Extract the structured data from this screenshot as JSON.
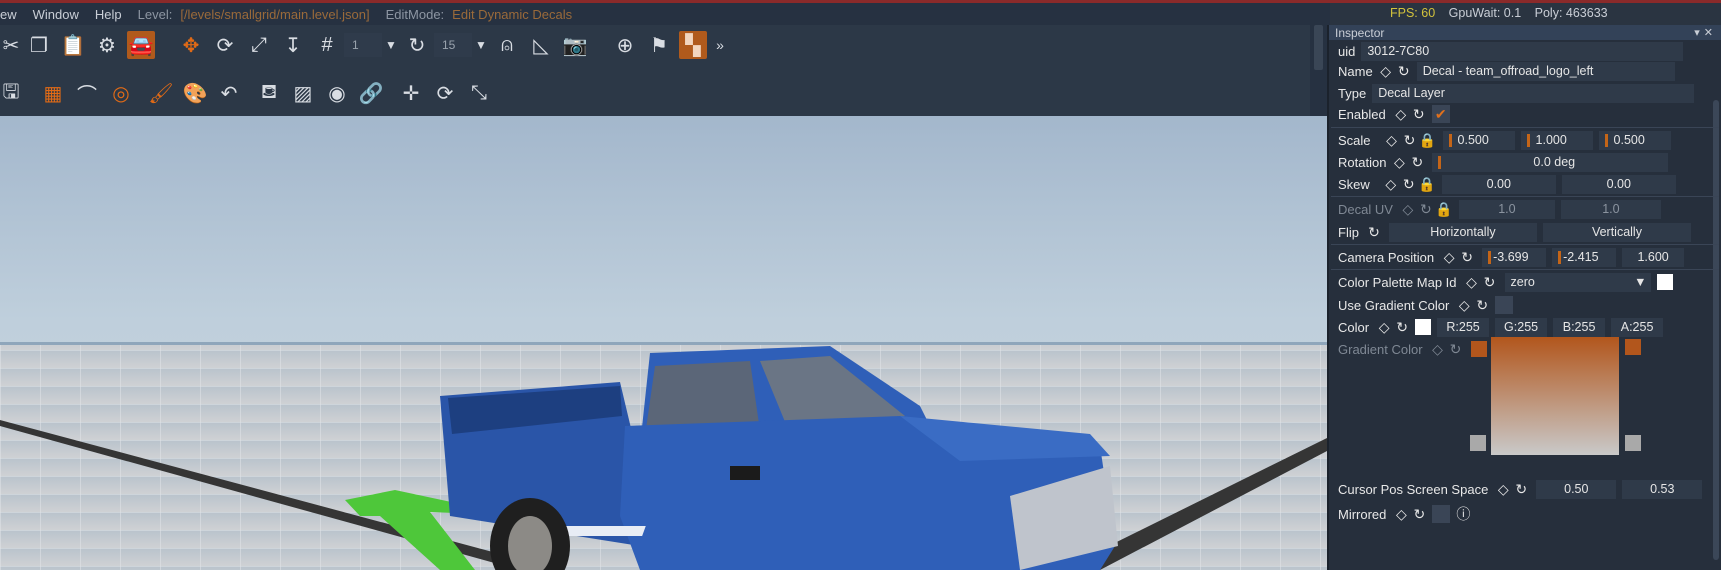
{
  "menu": {
    "items": [
      "ew",
      "Window",
      "Help"
    ],
    "level_label": "Level:",
    "level_path": "[/levels/smallgrid/main.level.json]",
    "editmode_label": "EditMode:",
    "editmode_value": "Edit Dynamic Decals"
  },
  "stats": {
    "fps": "FPS: 60",
    "gpuwait": "GpuWait: 0.1",
    "poly": "Poly: 463633"
  },
  "toolbar1": {
    "snap_value": "1",
    "rotate_value": "15"
  },
  "inspector": {
    "title": "Inspector",
    "uid_label": "uid",
    "uid_value": "3012-7C80",
    "name_label": "Name",
    "name_value": "Decal - team_offroad_logo_left",
    "type_label": "Type",
    "type_value": "Decal Layer",
    "enabled_label": "Enabled",
    "scale_label": "Scale",
    "scale_values": [
      "0.500",
      "1.000",
      "0.500"
    ],
    "rotation_label": "Rotation",
    "rotation_value": "0.0 deg",
    "skew_label": "Skew",
    "skew_values": [
      "0.00",
      "0.00"
    ],
    "decal_uv_label": "Decal UV",
    "decal_uv_values": [
      "1.0",
      "1.0"
    ],
    "flip_label": "Flip",
    "flip_h": "Horizontally",
    "flip_v": "Vertically",
    "camera_label": "Camera Position",
    "camera_values": [
      "-3.699",
      "-2.415",
      "1.600"
    ],
    "palette_label": "Color Palette Map Id",
    "palette_value": "zero",
    "gradient_use_label": "Use Gradient Color",
    "color_label": "Color",
    "color_values": [
      "R:255",
      "G:255",
      "B:255",
      "A:255"
    ],
    "gradient_label": "Gradient Color",
    "cursor_label": "Cursor Pos Screen Space",
    "cursor_values": [
      "0.50",
      "0.53"
    ],
    "mirrored_label": "Mirrored"
  },
  "colors": {
    "accent": "#e0701c",
    "gradient_top": "#b2561c",
    "gradient_bottom": "#c9c9c9",
    "truck_blue": "#2f5fb8"
  }
}
